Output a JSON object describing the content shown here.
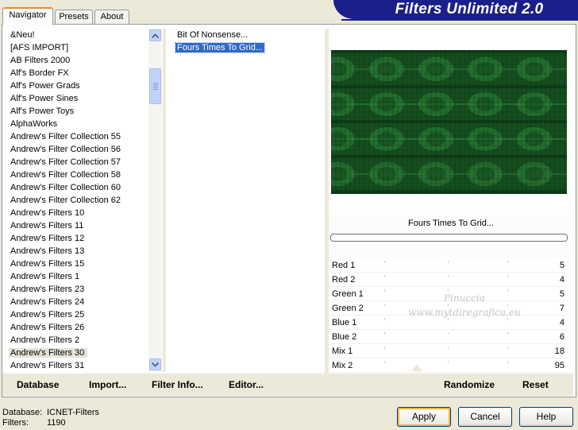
{
  "app_title": "Filters Unlimited 2.0",
  "tabs": [
    {
      "label": "Navigator"
    },
    {
      "label": "Presets"
    },
    {
      "label": "About"
    }
  ],
  "categories": [
    "&Neu!",
    "[AFS IMPORT]",
    "AB Filters 2000",
    "Alf's Border FX",
    "Alf's Power Grads",
    "Alf's Power Sines",
    "Alf's Power Toys",
    "AlphaWorks",
    "Andrew's Filter Collection 55",
    "Andrew's Filter Collection 56",
    "Andrew's Filter Collection 57",
    "Andrew's Filter Collection 58",
    "Andrew's Filter Collection 60",
    "Andrew's Filter Collection 62",
    "Andrew's Filters 10",
    "Andrew's Filters 11",
    "Andrew's Filters 12",
    "Andrew's Filters 13",
    "Andrew's Filters 15",
    "Andrew's Filters 1",
    "Andrew's Filters 23",
    "Andrew's Filters 24",
    "Andrew's Filters 25",
    "Andrew's Filters 26",
    "Andrew's Filters 2",
    "Andrew's Filters 30",
    "Andrew's Filters 31"
  ],
  "selected_category": "Andrew's Filters 30",
  "filters": [
    {
      "label": "Bit Of Nonsense...",
      "selected": false
    },
    {
      "label": "Fours Times To Grid...",
      "selected": true
    }
  ],
  "preview": {
    "filter_name": "Fours Times To Grid...",
    "colors": {
      "bg": "#0d3c17",
      "bright": "#2f8a3d",
      "mid": "#1d5e28",
      "dark": "#0a2a10"
    }
  },
  "params": [
    {
      "label": "Red 1",
      "value": "5"
    },
    {
      "label": "Red 2",
      "value": "4"
    },
    {
      "label": "Green 1",
      "value": "5"
    },
    {
      "label": "Green 2",
      "value": "7"
    },
    {
      "label": "Blue 1",
      "value": "4"
    },
    {
      "label": "Blue 2",
      "value": "6"
    },
    {
      "label": "Mix 1",
      "value": "18"
    },
    {
      "label": "Mix 2",
      "value": "95"
    }
  ],
  "watermark": {
    "line1": "Pinuccia",
    "line2": "www.mytdiregrafica.eu"
  },
  "left_buttons": {
    "database": "Database",
    "import": "Import...",
    "filter_info": "Filter Info...",
    "editor": "Editor..."
  },
  "right_buttons": {
    "randomize": "Randomize",
    "reset": "Reset"
  },
  "status": {
    "database_label": "Database:",
    "database_value": "ICNET-Filters",
    "filters_label": "Filters:",
    "filters_value": "1190"
  },
  "dialog_buttons": {
    "apply": "Apply",
    "cancel": "Cancel",
    "help": "Help"
  }
}
